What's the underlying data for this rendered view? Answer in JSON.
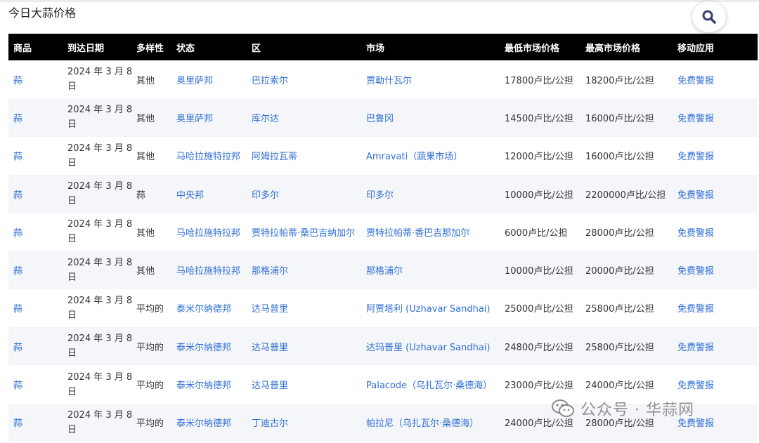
{
  "page": {
    "title": "今日大蒜价格"
  },
  "table": {
    "headers": [
      "商品",
      "到达日期",
      "多样性",
      "状态",
      "区",
      "市场",
      "最低市场价格",
      "最高市场价格",
      "移动应用"
    ],
    "rows": [
      [
        "蒜",
        "2024 年 3 月 8 日",
        "其他",
        "奥里萨邦",
        "巴拉索尔",
        "贾勒什瓦尔",
        "17800卢比/公担",
        "18200卢比/公担",
        "免费警报"
      ],
      [
        "蒜",
        "2024 年 3 月 8 日",
        "其他",
        "奥里萨邦",
        "库尔达",
        "巴鲁冈",
        "14500卢比/公担",
        "16000卢比/公担",
        "免费警报"
      ],
      [
        "蒜",
        "2024 年 3 月 8 日",
        "其他",
        "马哈拉施特拉邦",
        "阿姆拉瓦蒂",
        "Amravati（蔬果市场）",
        "12000卢比/公担",
        "16000卢比/公担",
        "免费警报"
      ],
      [
        "蒜",
        "2024 年 3 月 8 日",
        "蒜",
        "中央邦",
        "印多尔",
        "印多尔",
        "10000卢比/公担",
        "2200000卢比/公担",
        "免费警报"
      ],
      [
        "蒜",
        "2024 年 3 月 8 日",
        "其他",
        "马哈拉施特拉邦",
        "贾特拉帕蒂·桑巴吉纳加尔",
        "贾特拉帕蒂·香巴吉那加尔",
        "6000卢比/公担",
        "28000卢比/公担",
        "免费警报"
      ],
      [
        "蒜",
        "2024 年 3 月 8 日",
        "其他",
        "马哈拉施特拉邦",
        "那格浦尔",
        "那格浦尔",
        "10000卢比/公担",
        "20000卢比/公担",
        "免费警报"
      ],
      [
        "蒜",
        "2024 年 3 月 8 日",
        "平均的",
        "泰米尔纳德邦",
        "达马普里",
        "阿贾塔利 (Uzhavar Sandhai)",
        "25000卢比/公担",
        "25800卢比/公担",
        "免费警报"
      ],
      [
        "蒜",
        "2024 年 3 月 8 日",
        "平均的",
        "泰米尔纳德邦",
        "达马普里",
        "达玛普里 (Uzhavar Sandhai)",
        "24800卢比/公担",
        "25800卢比/公担",
        "免费警报"
      ],
      [
        "蒜",
        "2024 年 3 月 8 日",
        "平均的",
        "泰米尔纳德邦",
        "达马普里",
        "Palacode（乌扎瓦尔·桑德海）",
        "23000卢比/公担",
        "24000卢比/公担",
        "免费警报"
      ],
      [
        "蒜",
        "2024 年 3 月 8 日",
        "平均的",
        "泰米尔纳德邦",
        "丁迪古尔",
        "帕拉尼（乌扎瓦尔·桑德海）",
        "24000卢比/公担",
        "28000卢比/公担",
        "免费警报"
      ]
    ],
    "link_columns": [
      0,
      3,
      4,
      5,
      8
    ]
  },
  "watermark": {
    "text": "公众号 · 华蒜网",
    "icon": "wechat-icon"
  },
  "search": {
    "icon": "search-icon"
  }
}
